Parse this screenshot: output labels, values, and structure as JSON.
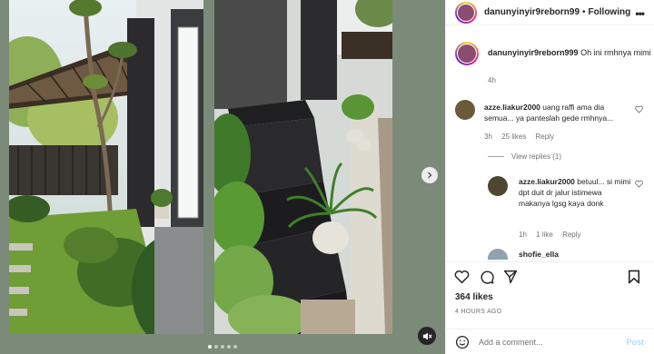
{
  "header": {
    "username": "danunyinyir9reborn99",
    "separator": "•",
    "follow_label": "Following",
    "more_label": "•••"
  },
  "caption": {
    "username": "danunyinyir9reborn999",
    "text": "Oh ini rmhnya mimi",
    "time": "4h"
  },
  "comments": [
    {
      "username": "azze.liakur2000",
      "text": "uang raffi ama dia semua... ya panteslah gede rmhnya...",
      "time": "3h",
      "likes": "25 likes",
      "reply_label": "Reply",
      "avatar_color": "#6b5a3a"
    }
  ],
  "view_replies_label": "View replies (1)",
  "replies": [
    {
      "username": "azze.liakur2000",
      "text": "betuul... si mimi dpt duit dr jalur istimewa makanya lgsg kaya donk",
      "time": "1h",
      "likes": "1 like",
      "reply_label": "Reply",
      "avatar_color": "#4d4630"
    }
  ],
  "partial_comment": {
    "username": "shofie_ella",
    "avatar_color": "#8fa3b0"
  },
  "likes_count": "364 likes",
  "post_time": "4 HOURS AGO",
  "add_comment": {
    "placeholder": "Add a comment...",
    "post_label": "Post"
  },
  "media": {
    "slide_count": 5,
    "active_slide": 1
  },
  "colors": {
    "media_background": "#7c8a79",
    "link_disabled": "#b3dbff",
    "muted_text": "#737373"
  }
}
